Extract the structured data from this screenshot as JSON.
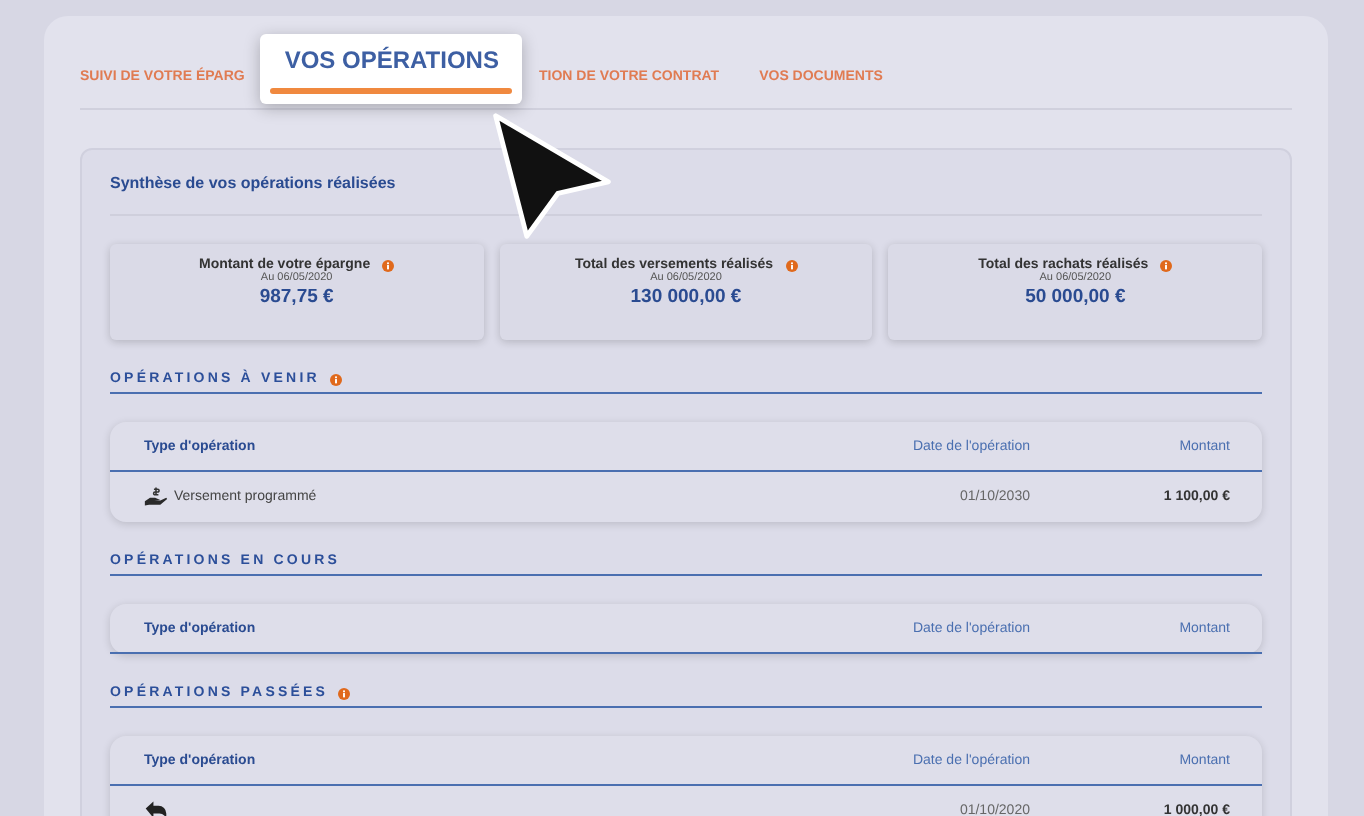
{
  "tabs": [
    {
      "label": "SUIVI DE VOTRE ÉPARG",
      "selected": false
    },
    {
      "label": "VOS OPÉRATIONS",
      "selected": true
    },
    {
      "label": "TION DE VOTRE CONTRAT",
      "selected": false
    },
    {
      "label": "VOS DOCUMENTS",
      "selected": false
    }
  ],
  "synthese": {
    "title": "Synthèse de vos opérations réalisées",
    "cards": [
      {
        "label": "Montant de votre épargne",
        "date": "Au 06/05/2020",
        "amount": "987,75 €"
      },
      {
        "label": "Total des versements réalisés",
        "date": "Au 06/05/2020",
        "amount": "130 000,00 €"
      },
      {
        "label": "Total des rachats réalisés",
        "date": "Au 06/05/2020",
        "amount": "50 000,00 €"
      }
    ]
  },
  "sections": [
    {
      "title": "OPÉRATIONS À VENIR",
      "info": true,
      "columns": [
        "Type d'opération",
        "Date de l'opération",
        "Montant"
      ],
      "rows": [
        {
          "kind": "payment",
          "type": "Versement programmé",
          "date": "01/10/2030",
          "amount": "1 100,00 €"
        }
      ]
    },
    {
      "title": "OPÉRATIONS EN COURS",
      "info": false,
      "columns": [
        "Type d'opération",
        "Date de l'opération",
        "Montant"
      ]
    },
    {
      "title": "OPÉRATIONS PASSÉES",
      "info": true,
      "columns": [
        "Type d'opération",
        "Date de l'opération",
        "Montant"
      ],
      "rows": [
        {
          "kind": "return",
          "date": "01/10/2020",
          "amount": "1 000,00 €"
        }
      ]
    }
  ]
}
